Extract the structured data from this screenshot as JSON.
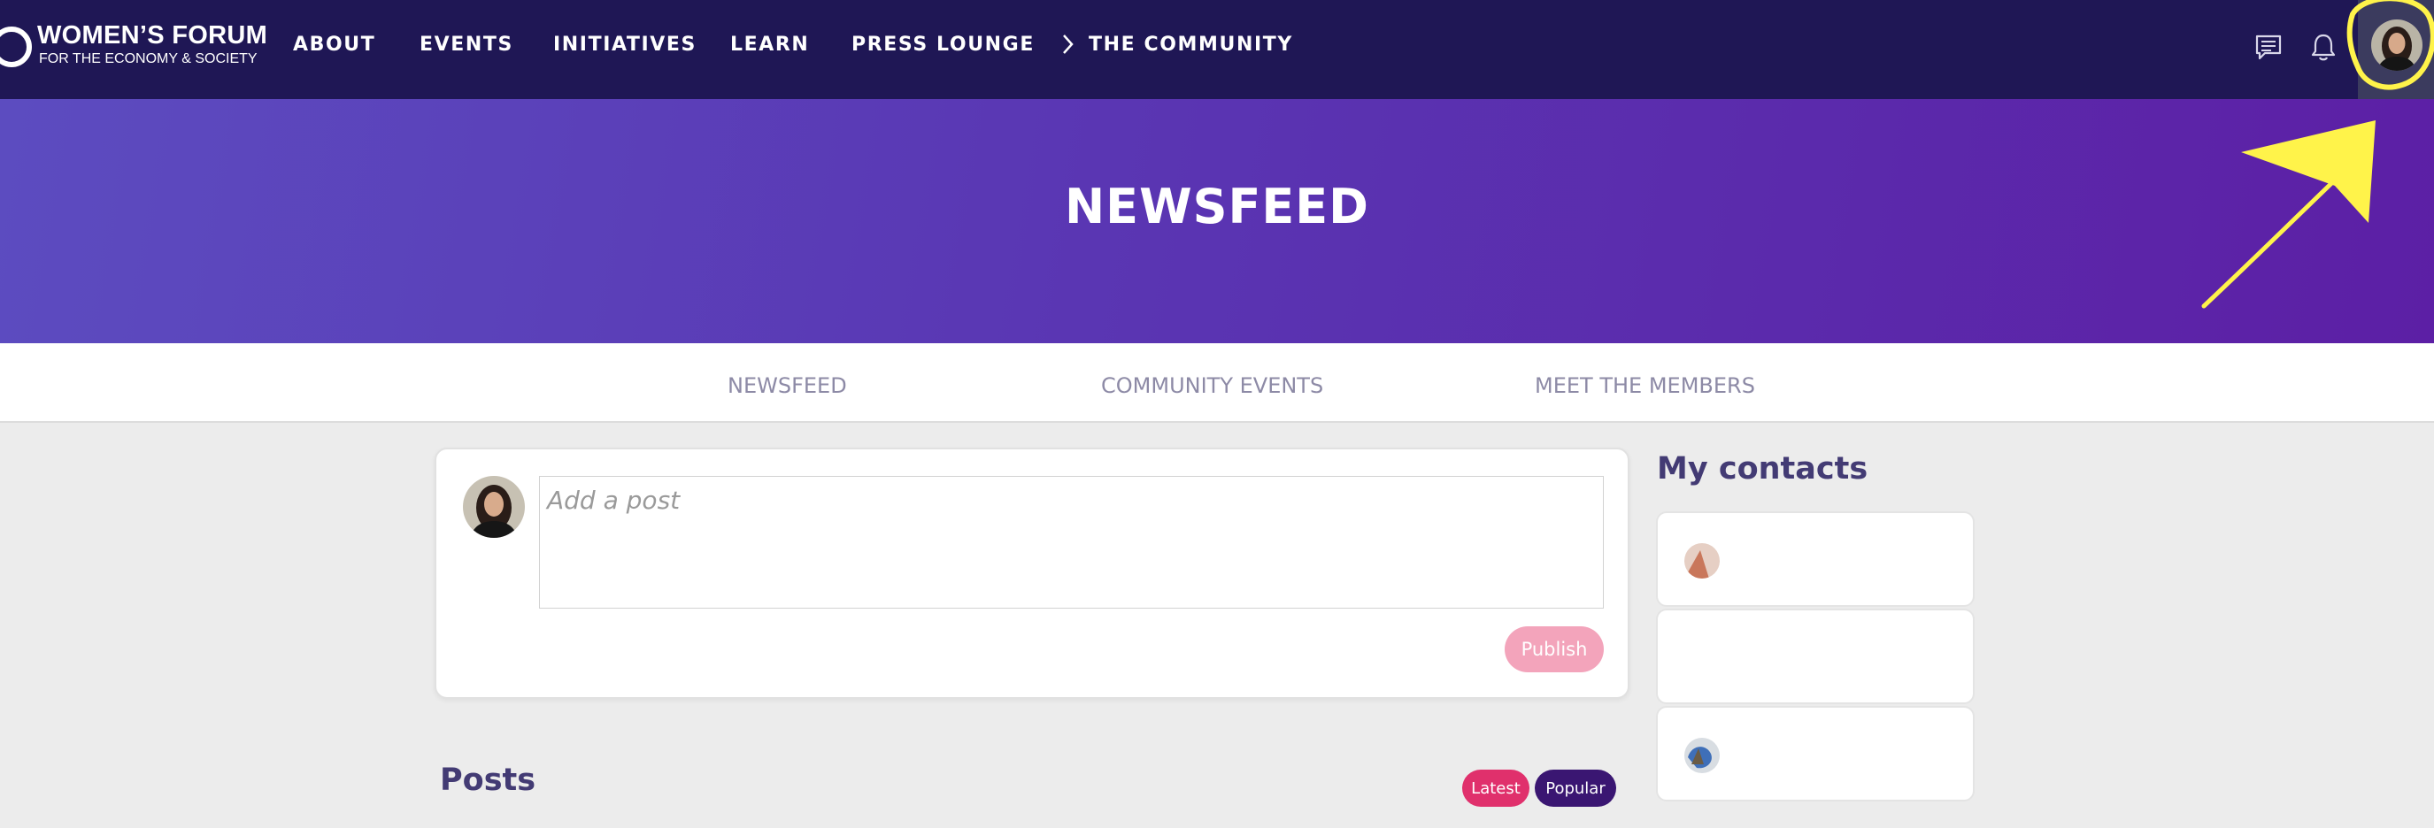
{
  "colors": {
    "navbar_bg": "#1f1755",
    "hero_gradient_start": "#5c4cc0",
    "hero_gradient_end": "#5c1fa5",
    "heading_text": "#433b74",
    "tab_text": "#8d8aa6",
    "publish_button": "#f3a4bb",
    "latest_pill": "#e0306c",
    "popular_pill": "#3a1672",
    "annotation": "#fff34a"
  },
  "header": {
    "logo": {
      "title": "WOMEN’S FORUM",
      "subtitle": "FOR THE ECONOMY & SOCIETY"
    },
    "nav": [
      {
        "label": "ABOUT"
      },
      {
        "label": "EVENTS"
      },
      {
        "label": "INITIATIVES"
      },
      {
        "label": "LEARN"
      },
      {
        "label": "PRESS LOUNGE"
      },
      {
        "label": "THE COMMUNITY",
        "icon": "chevron-right-icon"
      }
    ],
    "icons": [
      "chat-icon",
      "bell-icon",
      "avatar"
    ]
  },
  "hero": {
    "title": "NEWSFEED"
  },
  "tabs": [
    {
      "label": "NEWSFEED"
    },
    {
      "label": "COMMUNITY EVENTS"
    },
    {
      "label": "MEET THE MEMBERS"
    }
  ],
  "composer": {
    "placeholder": "Add a post",
    "value": "",
    "publish_label": "Publish"
  },
  "posts": {
    "title": "Posts",
    "filters": [
      {
        "label": "Latest",
        "active": true
      },
      {
        "label": "Popular",
        "active": false
      }
    ]
  },
  "contacts": {
    "title": "My contacts",
    "items": [
      {
        "avatar": "contact-avatar"
      },
      {
        "avatar": ""
      },
      {
        "avatar": "contact-avatar"
      }
    ]
  },
  "annotation": {
    "type": "yellow-circle-and-arrow",
    "target": "profile-avatar"
  }
}
